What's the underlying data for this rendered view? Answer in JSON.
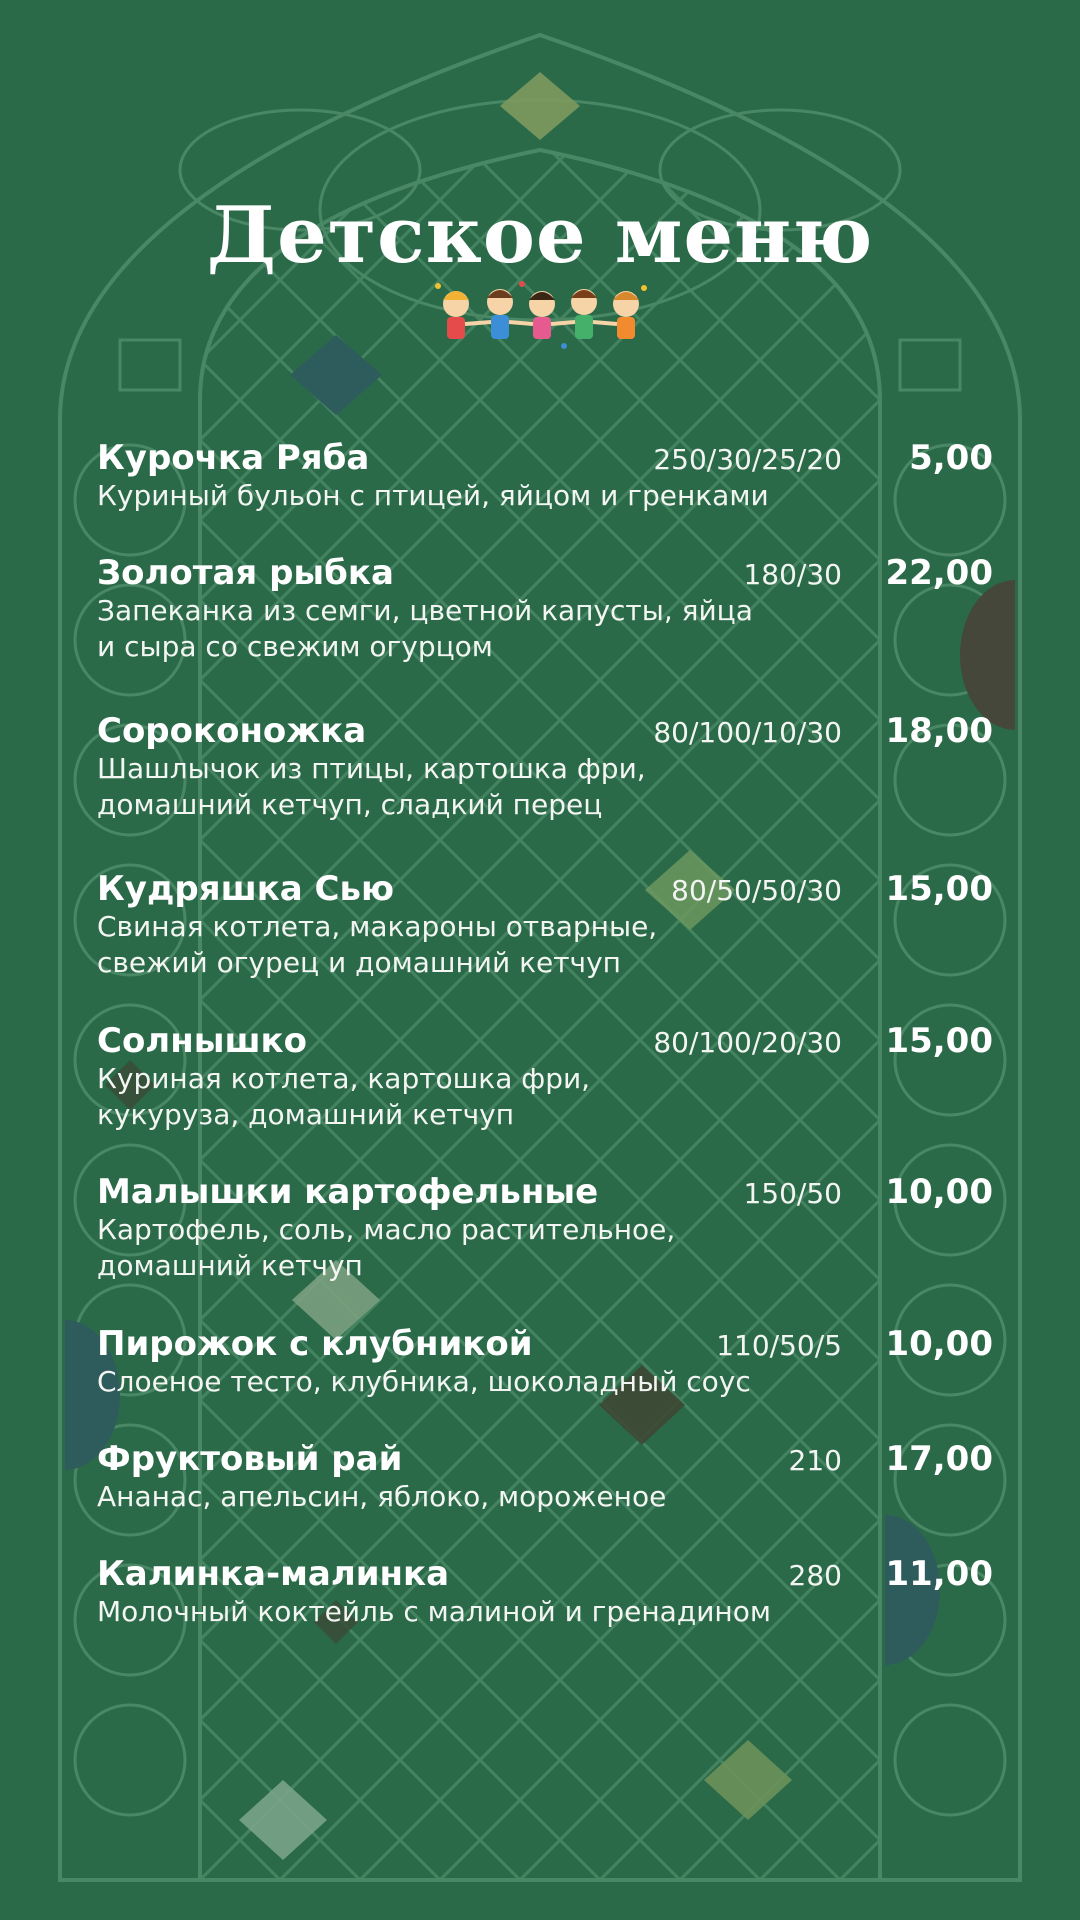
{
  "menu": {
    "title": "Детское меню",
    "illustration": "children-holding-hands-illustration",
    "colors": {
      "background": "#2b6a49",
      "pattern_line": "#4a8865",
      "text": "#ffffff"
    },
    "items": [
      {
        "name": "Курочка Ряба",
        "weight": "250/30/25/20",
        "price": "5,00",
        "description": "Куриный бульон с птицей, яйцом и гренками"
      },
      {
        "name": "Золотая рыбка",
        "weight": "180/30",
        "price": "22,00",
        "description": "Запеканка из семги, цветной капусты, яйца\nи сыра со свежим огурцом"
      },
      {
        "name": "Сороконожка",
        "weight": "80/100/10/30",
        "price": "18,00",
        "description": "Шашлычок из птицы, картошка фри,\nдомашний кетчуп, сладкий перец"
      },
      {
        "name": "Кудряшка Сью",
        "weight": "80/50/50/30",
        "price": "15,00",
        "description": "Свиная котлета, макароны отварные,\nсвежий огурец и домашний кетчуп"
      },
      {
        "name": "Солнышко",
        "weight": "80/100/20/30",
        "price": "15,00",
        "description": "Куриная котлета, картошка фри,\nкукуруза, домашний кетчуп"
      },
      {
        "name": "Малышки картофельные",
        "weight": "150/50",
        "price": "10,00",
        "description": "Картофель, соль, масло растительное,\nдомашний кетчуп"
      },
      {
        "name": "Пирожок с клубникой",
        "weight": "110/50/5",
        "price": "10,00",
        "description": "Слоеное тесто, клубника, шоколадный соус"
      },
      {
        "name": "Фруктовый рай",
        "weight": "210",
        "price": "17,00",
        "description": "Ананас, апельсин, яблоко, мороженое"
      },
      {
        "name": "Калинка-малинка",
        "weight": "280",
        "price": "11,00",
        "description": "Молочный коктейль с малиной и гренадином"
      }
    ]
  }
}
